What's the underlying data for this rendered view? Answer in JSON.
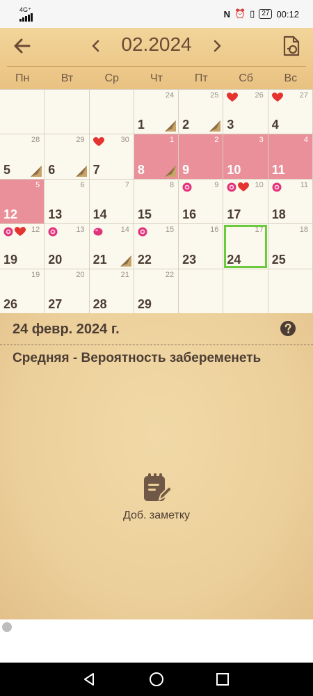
{
  "status": {
    "network": "4G⁺",
    "time": "00:12",
    "battery": "27"
  },
  "header": {
    "title": "02.2024",
    "weekdays": [
      "Пн",
      "Вт",
      "Ср",
      "Чт",
      "Пт",
      "Сб",
      "Вс"
    ]
  },
  "calendar": {
    "cells": [
      {
        "day": "",
        "small": ""
      },
      {
        "day": "",
        "small": ""
      },
      {
        "day": "",
        "small": ""
      },
      {
        "day": "1",
        "small": "24"
      },
      {
        "day": "2",
        "small": "25"
      },
      {
        "day": "3",
        "small": "26"
      },
      {
        "day": "4",
        "small": "27"
      },
      {
        "day": "5",
        "small": "28"
      },
      {
        "day": "6",
        "small": "29"
      },
      {
        "day": "7",
        "small": "30"
      },
      {
        "day": "8",
        "small": "1"
      },
      {
        "day": "9",
        "small": "2"
      },
      {
        "day": "10",
        "small": "3"
      },
      {
        "day": "11",
        "small": "4"
      },
      {
        "day": "12",
        "small": "5"
      },
      {
        "day": "13",
        "small": "6"
      },
      {
        "day": "14",
        "small": "7"
      },
      {
        "day": "15",
        "small": "8"
      },
      {
        "day": "16",
        "small": "9"
      },
      {
        "day": "17",
        "small": "10"
      },
      {
        "day": "18",
        "small": "11"
      },
      {
        "day": "19",
        "small": "12"
      },
      {
        "day": "20",
        "small": "13"
      },
      {
        "day": "21",
        "small": "14"
      },
      {
        "day": "22",
        "small": "15"
      },
      {
        "day": "23",
        "small": "16"
      },
      {
        "day": "24",
        "small": "17"
      },
      {
        "day": "25",
        "small": "18"
      },
      {
        "day": "26",
        "small": "19"
      },
      {
        "day": "27",
        "small": "20"
      },
      {
        "day": "28",
        "small": "21"
      },
      {
        "day": "29",
        "small": "22"
      },
      {
        "day": "",
        "small": ""
      },
      {
        "day": "",
        "small": ""
      },
      {
        "day": "",
        "small": ""
      }
    ]
  },
  "info": {
    "date": "24 февр. 2024 г.",
    "fertility": "Средняя - Вероятность забеременеть",
    "add_note": "Доб. заметку"
  },
  "colors": {
    "period": "#e9909a",
    "selected": "#6ccb3c",
    "text": "#4c3d34"
  }
}
